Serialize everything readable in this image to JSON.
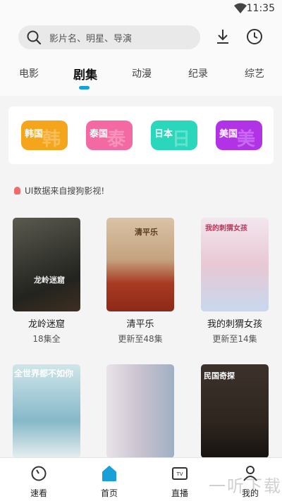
{
  "status": {
    "time": "11:35"
  },
  "search": {
    "placeholder": "影片名、明星、导演"
  },
  "tabs": [
    {
      "label": "电影"
    },
    {
      "label": "剧集"
    },
    {
      "label": "动漫"
    },
    {
      "label": "纪录"
    },
    {
      "label": "综艺"
    }
  ],
  "regions": [
    {
      "label": "韩国",
      "watermark": "韩",
      "color": "#f4a51c"
    },
    {
      "label": "泰国",
      "watermark": "泰",
      "color": "#f36aa3"
    },
    {
      "label": "日本",
      "watermark": "日",
      "color": "#2ad7ba"
    },
    {
      "label": "美国",
      "watermark": "美",
      "color": "#b233e6"
    }
  ],
  "notice": "UI数据来自搜狗影视!",
  "shows": [
    {
      "title": "龙岭迷窟",
      "sub": "18集全",
      "poster_text": "龙岭迷窟",
      "color": "#3b3b36"
    },
    {
      "title": "清平乐",
      "sub": "更新至48集",
      "poster_text": "清平乐",
      "color": "#c4a27f"
    },
    {
      "title": "我的刺猬女孩",
      "sub": "更新至14集",
      "poster_text": "我的刺猬女孩",
      "color": "#e8c8d4"
    },
    {
      "title": "",
      "sub": "",
      "poster_text": "全世界都不如你",
      "color": "#86b8c8"
    },
    {
      "title": "",
      "sub": "",
      "poster_text": "",
      "color": "#c9c2cf"
    },
    {
      "title": "",
      "sub": "",
      "poster_text": "民国奇探",
      "color": "#2f2620"
    }
  ],
  "nav": [
    {
      "label": "速看"
    },
    {
      "label": "首页"
    },
    {
      "label": "直播"
    },
    {
      "label": "我的"
    }
  ],
  "watermark": "一听下载",
  "colors": {
    "accent": "#1aa0d8"
  }
}
